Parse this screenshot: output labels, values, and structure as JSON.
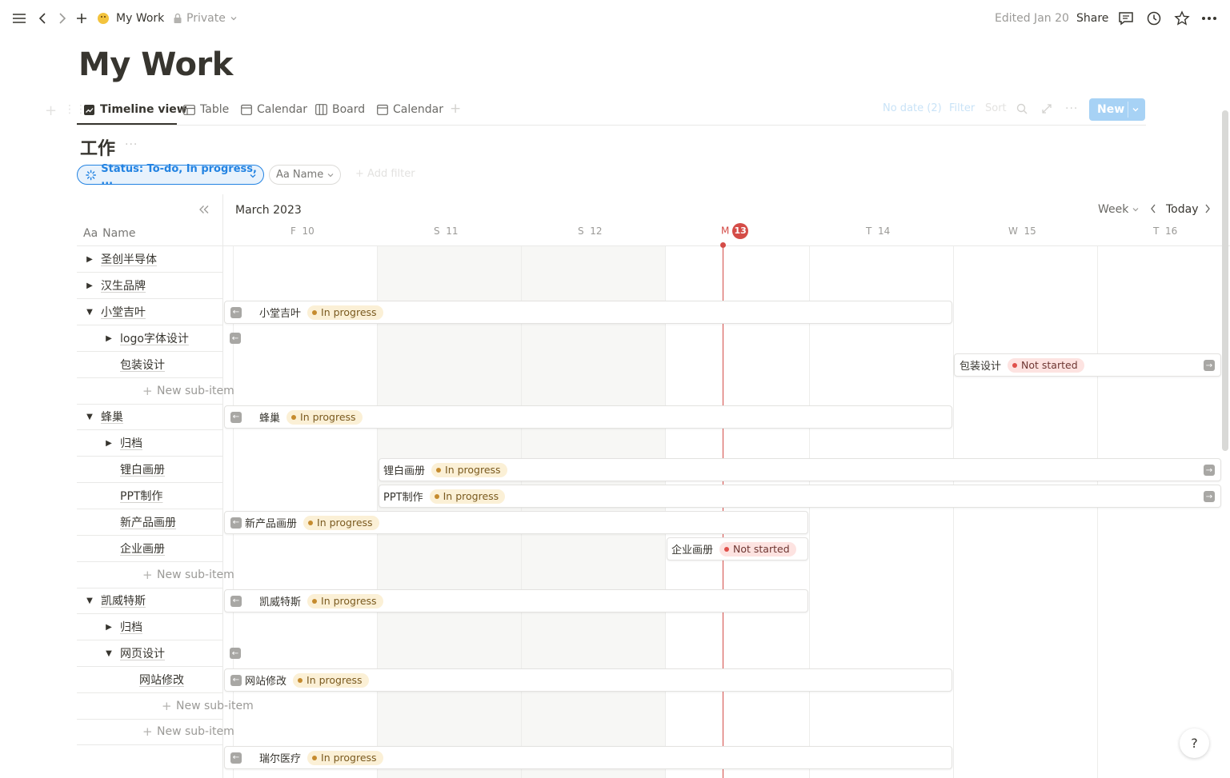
{
  "topbar": {
    "page_name": "My Work",
    "privacy": "Private",
    "edited": "Edited Jan 20",
    "share": "Share"
  },
  "page": {
    "title": "My Work"
  },
  "views": {
    "tabs": [
      {
        "label": "Timeline view",
        "icon": "timeline-icon"
      },
      {
        "label": "Table",
        "icon": "table-icon"
      },
      {
        "label": "Calendar",
        "icon": "calendar-icon"
      },
      {
        "label": "Board",
        "icon": "board-icon"
      },
      {
        "label": "Calendar",
        "icon": "calendar-icon"
      }
    ],
    "no_date": "No date (2)",
    "filter": "Filter",
    "sort": "Sort",
    "new": "New"
  },
  "database": {
    "title": "工作",
    "filters": {
      "status": "Status: To-do, In progress, ...",
      "name_prefix": "Aa",
      "name": "Name",
      "add": "+ Add filter"
    }
  },
  "timeline": {
    "month": "March 2023",
    "scale": "Week",
    "today": "Today",
    "column_prefix": "Aa",
    "column_header": "Name",
    "days": [
      {
        "dow": "F",
        "num": "10"
      },
      {
        "dow": "S",
        "num": "11"
      },
      {
        "dow": "S",
        "num": "12"
      },
      {
        "dow": "M",
        "num": "13"
      },
      {
        "dow": "T",
        "num": "14"
      },
      {
        "dow": "W",
        "num": "15"
      },
      {
        "dow": "T",
        "num": "16"
      }
    ],
    "rows": [
      {
        "label": "圣创半导体",
        "toggle": "collapsed",
        "level": 0
      },
      {
        "label": "汉生品牌",
        "toggle": "collapsed",
        "level": 0
      },
      {
        "label": "小堂吉叶",
        "toggle": "expanded",
        "level": 0
      },
      {
        "label": "logo字体设计",
        "toggle": "collapsed",
        "level": 1
      },
      {
        "label": "包装设计",
        "toggle": "none",
        "level": 1
      },
      {
        "label": "New sub-item",
        "toggle": "new",
        "level": 1
      },
      {
        "label": "蜂巢",
        "toggle": "expanded",
        "level": 0
      },
      {
        "label": "归档",
        "toggle": "collapsed",
        "level": 1
      },
      {
        "label": "锂白画册",
        "toggle": "none",
        "level": 1
      },
      {
        "label": "PPT制作",
        "toggle": "none",
        "level": 1
      },
      {
        "label": "新产品画册",
        "toggle": "none",
        "level": 1
      },
      {
        "label": "企业画册",
        "toggle": "none",
        "level": 1
      },
      {
        "label": "New sub-item",
        "toggle": "new",
        "level": 1
      },
      {
        "label": "凯威特斯",
        "toggle": "expanded",
        "level": 0
      },
      {
        "label": "归档",
        "toggle": "collapsed",
        "level": 1
      },
      {
        "label": "网页设计",
        "toggle": "expanded",
        "level": 1
      },
      {
        "label": "网站修改",
        "toggle": "none",
        "level": 2
      },
      {
        "label": "New sub-item",
        "toggle": "new",
        "level": 2
      },
      {
        "label": "New sub-item",
        "toggle": "new",
        "level": 1
      }
    ],
    "bars": [
      {
        "title": "小堂吉叶",
        "status": "In progress"
      },
      {
        "title": "包装设计",
        "status": "Not started"
      },
      {
        "title": "蜂巢",
        "status": "In progress"
      },
      {
        "title": "锂白画册",
        "status": "In progress"
      },
      {
        "title": "PPT制作",
        "status": "In progress"
      },
      {
        "title": "新产品画册",
        "status": "In progress"
      },
      {
        "title": "企业画册",
        "status": "Not started"
      },
      {
        "title": "凯威特斯",
        "status": "In progress"
      },
      {
        "title": "网站修改",
        "status": "In progress"
      },
      {
        "title": "瑞尔医疗",
        "status": "In progress"
      }
    ]
  },
  "colors": {
    "accent": "#2383e2",
    "today": "#d44c47",
    "in_progress_bg": "#fbf0d6",
    "not_started_bg": "#fde3e1"
  }
}
